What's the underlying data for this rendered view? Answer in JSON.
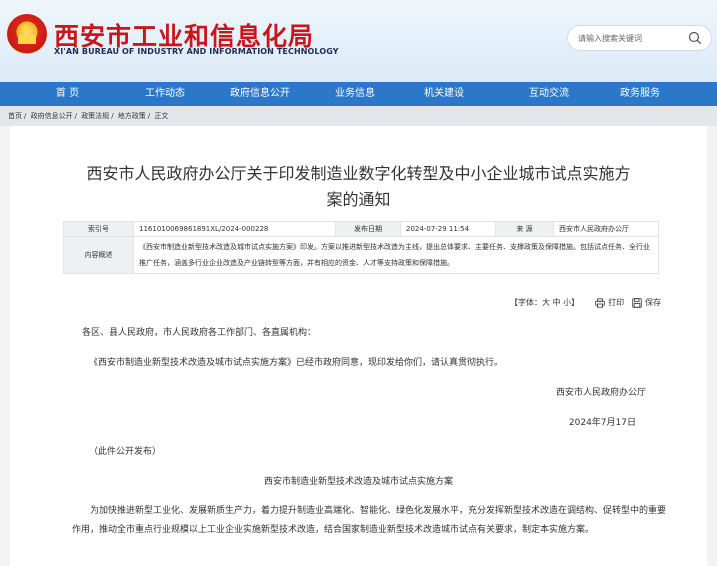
{
  "header": {
    "title": "西安市工业和信息化局",
    "subtitle": "XI'AN BUREAU OF INDUSTRY AND INFORMATION TECHNOLOGY",
    "search_placeholder": "请输入搜索关键词"
  },
  "nav": {
    "items": [
      "首 页",
      "工作动态",
      "政府信息公开",
      "业务信息",
      "机关建设",
      "互动交流",
      "政务服务"
    ]
  },
  "breadcrumb": [
    "首页",
    "政府信息公开",
    "政策法规",
    "地方政策",
    "正文"
  ],
  "article": {
    "title_line1": "西安市人民政府办公厅关于印发制造业数字化转型及中小企业城市试点实施方",
    "title_line2": "案的通知",
    "meta": {
      "index_label": "索引号",
      "index_value": "1161010069861891XL/2024-000228",
      "date_label": "发布日期",
      "date_value": "2024-07-29 11:54",
      "source_label": "来 源",
      "source_value": "西安市人民政府办公厅",
      "summary_label": "内容概述",
      "summary_value": "《西安市制造业新型技术改造及城市试点实施方案》印发。方案以推进新型技术改造为主线，提出总体要求、主要任务、支撑政策及保障措施。包括试点任务、全行业推广任务，涵盖多行业企业改造及产业链转型等方面，并有相应的资金、人才等支持政策和保障措施。"
    },
    "tools": {
      "font_size": "【字体：大 中 小】",
      "print": "打印",
      "save": "保存"
    },
    "salutation": "各区、县人民政府，市人民政府各工作部门、各直属机构：",
    "notice": "《西安市制造业新型技术改造及城市试点实施方案》已经市政府同意，现印发给你们，请认真贯彻执行。",
    "signer": "西安市人民政府办公厅",
    "date": "2024年7月17日",
    "publish_note": "（此件公开发布）",
    "plan_title": "西安市制造业新型技术改造及城市试点实施方案",
    "intro": "为加快推进新型工业化、发展新质生产力，着力提升制造业高端化、智能化、绿色化发展水平，充分发挥新型技术改造在调结构、促转型中的重要作用，推动全市重点行业规模以上工业企业实施新型技术改造，结合国家制造业新型技术改造城市试点有关要求，制定本实施方案。"
  },
  "colors": {
    "brand_red": "#c7161c",
    "nav_blue": "#2b78c9"
  }
}
